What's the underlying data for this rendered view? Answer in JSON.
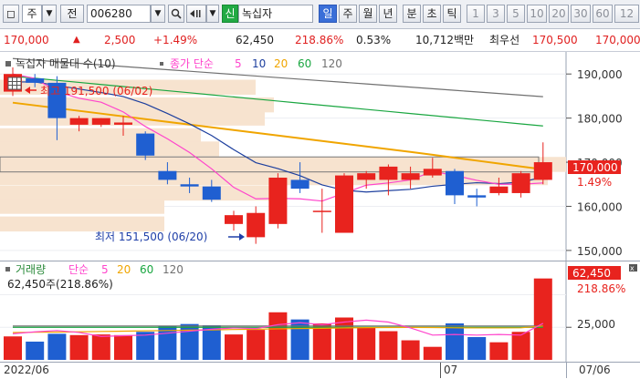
{
  "toolbar": {
    "market_select": "주",
    "jeon_label": "전",
    "code": "006280",
    "sin_label": "신",
    "stock_name": "녹십자",
    "periods": [
      "일",
      "주",
      "월",
      "년",
      "분",
      "초",
      "틱"
    ],
    "active_period": "일",
    "intervals": [
      "1",
      "3",
      "5",
      "10",
      "20",
      "30",
      "60",
      "12"
    ]
  },
  "quote": {
    "price": "170,000",
    "change": "2,500",
    "change_pct": "+1.49%",
    "volume": "62,450",
    "volume_ratio": "218.86%",
    "turnover_rate": "0.53%",
    "amount": "10,712백만",
    "best_label": "최우선",
    "ask": "170,500",
    "bid": "170,000"
  },
  "price_panel": {
    "title": "녹십자 매물대 수(10)",
    "ma_label": "종가 단순",
    "ma_periods": [
      "5",
      "10",
      "20",
      "60",
      "120"
    ],
    "high_annotation": "최고 191,500 (06/02)",
    "low_annotation": "최저 151,500 (06/20)",
    "y_ticks": [
      "190,000",
      "180,000",
      "170,000",
      "160,000",
      "150,000"
    ],
    "current_price_tag": "170,000",
    "current_pct_tag": "1.49%"
  },
  "volume_panel": {
    "title": "거래량",
    "ma_label": "단순",
    "ma_periods": [
      "5",
      "20",
      "60",
      "120"
    ],
    "readout": "62,450주(218.86%)",
    "y_tick": "25,000",
    "current_tag": "62,450",
    "current_pct": "218.86%"
  },
  "x_axis": {
    "left_label": "2022/06",
    "mid_label": "07",
    "right_label": "07/06"
  },
  "colors": {
    "up": "#e8231e",
    "down": "#1f5fd1",
    "ma5": "#ff44cc",
    "ma10": "#1d3f9e",
    "ma20": "#f0a500",
    "ma60": "#19a640",
    "ma120": "#707070",
    "volume_profile": "#f7e3cf"
  },
  "chart_data": {
    "type": "candlestick",
    "candles": [
      {
        "o": 186000,
        "h": 191500,
        "l": 185000,
        "c": 190000
      },
      {
        "o": 189000,
        "h": 190000,
        "l": 187000,
        "c": 188000
      },
      {
        "o": 188000,
        "h": 189500,
        "l": 175000,
        "c": 180000
      },
      {
        "o": 178500,
        "h": 180500,
        "l": 177000,
        "c": 180000
      },
      {
        "o": 178500,
        "h": 180000,
        "l": 178000,
        "c": 180000
      },
      {
        "o": 178500,
        "h": 180500,
        "l": 176000,
        "c": 179000
      },
      {
        "o": 176500,
        "h": 177000,
        "l": 170500,
        "c": 171500
      },
      {
        "o": 168000,
        "h": 170000,
        "l": 165000,
        "c": 166000
      },
      {
        "o": 165000,
        "h": 166500,
        "l": 163000,
        "c": 164500
      },
      {
        "o": 164500,
        "h": 166000,
        "l": 161000,
        "c": 161500
      },
      {
        "o": 156000,
        "h": 159000,
        "l": 154500,
        "c": 158000
      },
      {
        "o": 153000,
        "h": 160000,
        "l": 151500,
        "c": 158500
      },
      {
        "o": 156000,
        "h": 167500,
        "l": 155000,
        "c": 166500
      },
      {
        "o": 166000,
        "h": 170000,
        "l": 163000,
        "c": 164000
      },
      {
        "o": 159000,
        "h": 164000,
        "l": 154000,
        "c": 159000
      },
      {
        "o": 154000,
        "h": 167500,
        "l": 154000,
        "c": 167000
      },
      {
        "o": 166000,
        "h": 168000,
        "l": 164000,
        "c": 167500
      },
      {
        "o": 166000,
        "h": 169500,
        "l": 162500,
        "c": 169000
      },
      {
        "o": 166000,
        "h": 169000,
        "l": 164000,
        "c": 167500
      },
      {
        "o": 167000,
        "h": 171000,
        "l": 166500,
        "c": 168500
      },
      {
        "o": 168000,
        "h": 168500,
        "l": 160500,
        "c": 162500
      },
      {
        "o": 162500,
        "h": 164000,
        "l": 160000,
        "c": 162000
      },
      {
        "o": 163000,
        "h": 166500,
        "l": 162500,
        "c": 164500
      },
      {
        "o": 163000,
        "h": 168000,
        "l": 162000,
        "c": 167500
      },
      {
        "o": 166000,
        "h": 174500,
        "l": 165000,
        "c": 170000
      }
    ],
    "volumes": [
      18000,
      14000,
      20000,
      19000,
      19500,
      19000,
      21500,
      26000,
      27500,
      26500,
      19500,
      23000,
      36500,
      31000,
      28000,
      32500,
      25000,
      22000,
      15000,
      10000,
      28000,
      17500,
      13500,
      21500,
      62450
    ],
    "volume_ma5": [
      20000,
      21500,
      22500,
      21000,
      18000,
      18500,
      19000,
      20500,
      22000,
      23500,
      24500,
      24000,
      27000,
      28500,
      27000,
      29000,
      30500,
      29000,
      24500,
      19000,
      19500,
      19000,
      19500,
      19000,
      28000
    ],
    "volume_ma20": [
      21000,
      21200,
      21300,
      21500,
      21800,
      22000,
      22300,
      22500,
      22800,
      23000,
      23300,
      23500,
      23800,
      24000,
      24200,
      24500,
      24700,
      24800,
      24900,
      24800,
      24600,
      24500,
      24500,
      24600,
      26000
    ],
    "volume_ma60": [
      25000,
      25000,
      25000,
      25000,
      25000,
      25000,
      25000,
      25000,
      25000,
      25000,
      25000,
      25000,
      25000,
      25000,
      25000,
      25000,
      25000,
      25000,
      25000,
      25000,
      25000,
      25000,
      25000,
      25000,
      25000
    ],
    "volume_ma120": [
      26000,
      26000,
      26000,
      26000,
      26000,
      26000,
      26000,
      26000,
      26000,
      26000,
      26000,
      26000,
      26000,
      26000,
      26000,
      26000,
      26000,
      26000,
      26000,
      26000,
      26000,
      26000,
      26000,
      26000,
      26000
    ],
    "price_ylim": [
      147500,
      195000
    ],
    "volume_ylim": [
      0,
      65000
    ]
  }
}
